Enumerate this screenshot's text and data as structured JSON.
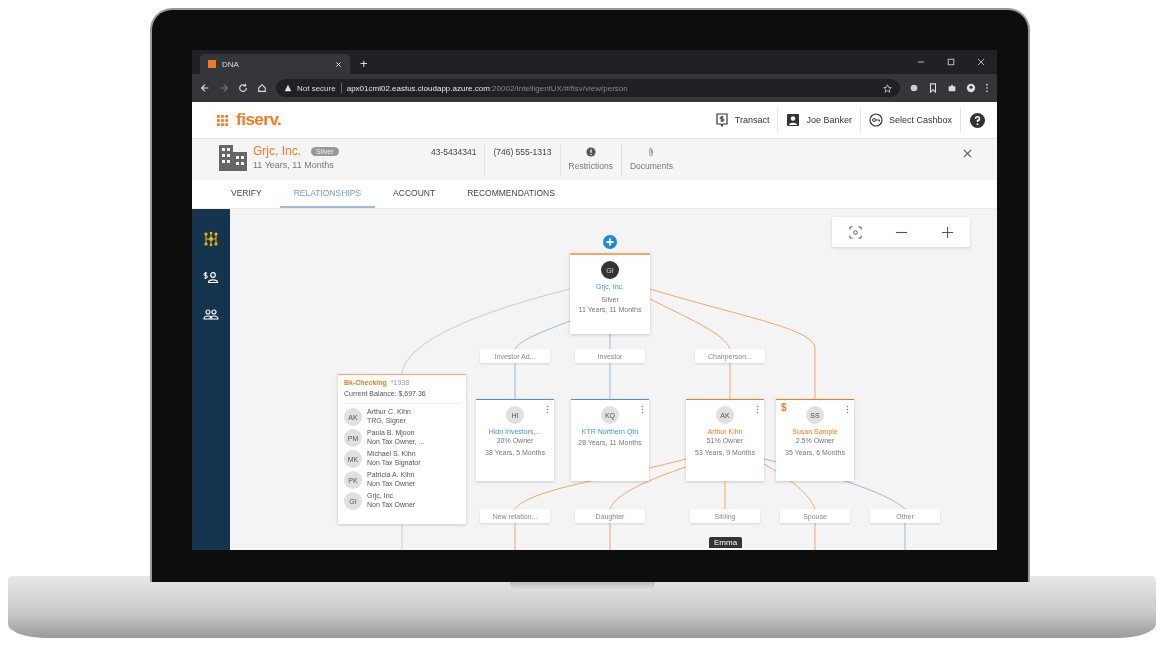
{
  "browser": {
    "tab": {
      "title": "DNA"
    },
    "new_tab": "+",
    "address": {
      "security": "Not secure",
      "host": "apx01cml02.eastus.cloudapp.azure.com",
      "path": ":20002/IntelligentUX/#/fisv/view/person"
    }
  },
  "header": {
    "logo": "fiserv.",
    "actions": [
      {
        "kind": "transact",
        "label": "Transact"
      },
      {
        "kind": "user",
        "label": "Joe Banker"
      },
      {
        "kind": "key",
        "label": "Select Cashbox"
      }
    ]
  },
  "entity": {
    "name": "Grjc, Inc.",
    "tier": "Silver",
    "tenure": "11 Years, 11 Months",
    "tax_id": "43-5434341",
    "phone": "(746) 555-1313",
    "actions": [
      {
        "kind": "alert",
        "label": "Restrictions"
      },
      {
        "kind": "clip",
        "label": "Documents"
      }
    ]
  },
  "tabs": [
    {
      "label": "VERIFY",
      "selected": false
    },
    {
      "label": "RELATIONSHIPS",
      "selected": true
    },
    {
      "label": "ACCOUNT",
      "selected": false
    },
    {
      "label": "RECOMMENDATIONS",
      "selected": false
    }
  ],
  "sidebar": {
    "items": [
      {
        "kind": "network",
        "selected": true
      },
      {
        "kind": "finance",
        "selected": false
      },
      {
        "kind": "people",
        "selected": false
      }
    ]
  },
  "graph": {
    "root": {
      "initials": "GI",
      "name": "Grjc, Inc.",
      "tier": "Silver",
      "tenure": "11 Years, 11 Months"
    },
    "upper_labels": [
      "Investor Ad...",
      "Investor",
      "Chairperson..."
    ],
    "account": {
      "title": "Bk-Checking",
      "number": "*1938",
      "balance": "Current Balance: $,697.36",
      "members": [
        {
          "initials": "AK",
          "name": "Arthur C. Kihn",
          "role": "TRG, Signer"
        },
        {
          "initials": "PM",
          "name": "Paula B. Mjoon",
          "role": "Non Tax Owner, ..."
        },
        {
          "initials": "MK",
          "name": "Michael S. Kihn",
          "role": "Non Tax Signator"
        },
        {
          "initials": "PK",
          "name": "Patricia A. Kihn",
          "role": "Non Tax Owner"
        },
        {
          "initials": "GI",
          "name": "Grjc, Inc.",
          "role": "Non Tax Owner"
        }
      ]
    },
    "nodes": [
      {
        "initials": "HI",
        "name": "Hidn Investors,...",
        "share": "20% Owner",
        "tenure": "38 Years, 5 Months",
        "color": "#4a90d9"
      },
      {
        "initials": "KQ",
        "name": "KTR Northern Qtn",
        "tenure": "28 Years, 11 Months",
        "color": "#4a90d9"
      },
      {
        "initials": "AK",
        "name": "Arthur Kihn",
        "share": "51% Owner",
        "tenure": "53 Years, 9 Months",
        "color": "#f47a20"
      },
      {
        "initials": "SS",
        "name": "Susan Sample",
        "share": "2.5% Owner",
        "tenure": "35 Years, 6 Months",
        "color": "#f47a20",
        "dollar_sign": "$"
      }
    ],
    "lower_labels": [
      "New relation...",
      "Daughter",
      "Sibling",
      "Spouse",
      "Other"
    ],
    "tooltip": "Emma"
  }
}
